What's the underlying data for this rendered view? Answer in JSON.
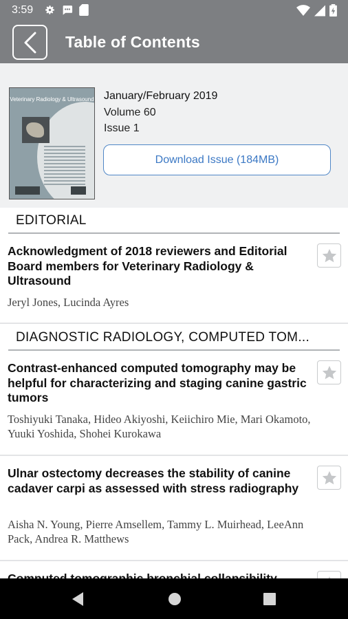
{
  "status_bar": {
    "time": "3:59",
    "left_icons": [
      "gear-icon",
      "chat-icon",
      "sd-card-icon"
    ],
    "right_icons": [
      "wifi-icon",
      "signal-icon",
      "battery-icon"
    ]
  },
  "app_bar": {
    "title": "Table of Contents",
    "back_icon": "chevron-left-icon",
    "color": "#7d7f82"
  },
  "issue": {
    "date": "January/February 2019",
    "volume": "Volume 60",
    "issue": "Issue 1",
    "download_label": "Download Issue (184MB)",
    "cover_title": "Veterinary Radiology & Ultrasound"
  },
  "sections": [
    {
      "heading": "EDITORIAL",
      "articles": [
        {
          "title": "Acknowledgment of 2018 reviewers and Editorial Board members for Veterinary Radiology & Ultrasound",
          "authors": "Jeryl Jones, Lucinda Ayres"
        }
      ]
    },
    {
      "heading": "DIAGNOSTIC RADIOLOGY, COMPUTED TOM...",
      "articles": [
        {
          "title": "Contrast-enhanced computed tomography may be helpful for characterizing and staging canine gastric tumors",
          "authors": "Toshiyuki Tanaka, Hideo Akiyoshi, Keiichiro Mie, Mari Okamoto, Yuuki Yoshida, Shohei Kurokawa"
        },
        {
          "title": "Ulnar ostectomy decreases the stability of canine cadaver carpi as assessed with stress radiography",
          "authors": "Aisha N. Young, Pierre Amsellem, Tammy L. Muirhead, LeeAnn Pack, Andrea R. Matthews"
        },
        {
          "title": "Computed tomographic bronchial collapsibility",
          "authors": ""
        }
      ]
    }
  ],
  "colors": {
    "accent": "#3b78c4",
    "header_bg": "#f0f1f2"
  }
}
